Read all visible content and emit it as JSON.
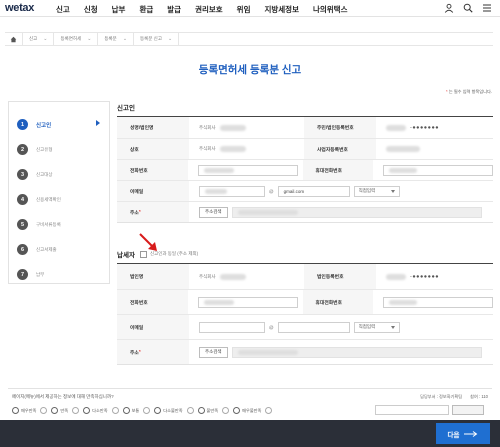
{
  "nav": {
    "logo": "wetax",
    "menu": [
      "신고",
      "신청",
      "납부",
      "환급",
      "발급",
      "권리보호",
      "위임",
      "지방세정보",
      "나의위택스"
    ],
    "icons": [
      "user-icon",
      "search-icon",
      "menu-icon"
    ]
  },
  "breadcrumb": {
    "items": [
      "신고",
      "등록면허세",
      "등록분",
      "등록분 신고"
    ]
  },
  "page": {
    "title": "등록면허세 등록분 신고",
    "required_note": "는 필수 입력 항목입니다.",
    "required_star": "*"
  },
  "steps": [
    {
      "num": "1",
      "label": "신고인",
      "active": true
    },
    {
      "num": "2",
      "label": "신고유형",
      "active": false
    },
    {
      "num": "3",
      "label": "신고대상",
      "active": false
    },
    {
      "num": "4",
      "label": "신용세액확인",
      "active": false
    },
    {
      "num": "5",
      "label": "구비서류등록",
      "active": false
    },
    {
      "num": "6",
      "label": "신고서제출",
      "active": false
    },
    {
      "num": "7",
      "label": "납부",
      "active": false
    }
  ],
  "reporter": {
    "title": "신고인",
    "name_label": "성명/법인명",
    "name_value": "주식회사",
    "reg_label": "주민/법인등록번호",
    "reg_value": "-●●●●●●●",
    "company_label": "상호",
    "company_value": "주식회사",
    "biz_label": "사업자등록번호",
    "phone_label": "전화번호",
    "mobile_label": "휴대전화번호",
    "email_label": "이메일",
    "email_at": "@",
    "email_domain": "gmail.com",
    "email_select": "직접입력",
    "addr_label": "주소",
    "addr_star": "*",
    "addr_button": "주소검색"
  },
  "taxpayer": {
    "title": "납세자",
    "same_checkbox_label": "신고인과 동일 (주소 제외)",
    "name_label": "법인명",
    "name_value": "주식회사",
    "reg_label": "법인등록번호",
    "reg_value": "-●●●●●●●",
    "phone_label": "전화번호",
    "mobile_label": "휴대전화번호",
    "email_label": "이메일",
    "email_at": "@",
    "email_select": "직접입력",
    "addr_label": "주소",
    "addr_star": "*",
    "addr_button": "주소검색"
  },
  "satisfaction": {
    "question": "페이지(메뉴)에서 제공하는 정보에 대해 만족하십니까?",
    "dept": "담당부서 : 정보화기획팀",
    "count": "참여 : 110",
    "options": [
      "매우만족",
      "만족",
      "다소만족",
      "보통",
      "다소불만족",
      "불만족",
      "매우불만족"
    ]
  },
  "footer": {
    "next_label": "다음"
  }
}
